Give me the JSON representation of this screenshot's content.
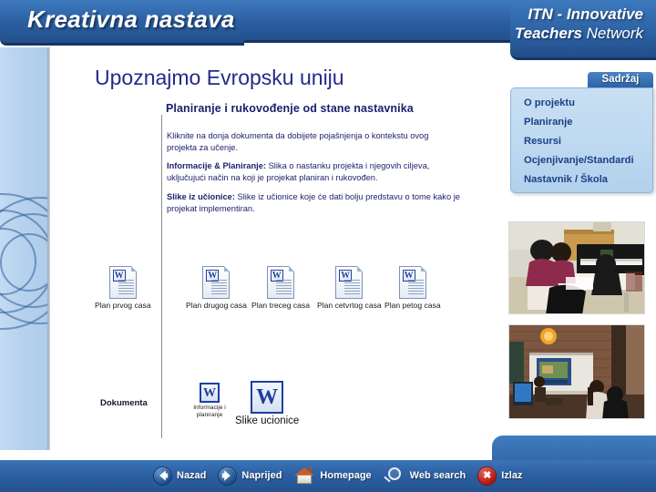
{
  "header": {
    "brand_title": "Kreativna nastava",
    "itn_line1": "ITN - Innovative",
    "itn_line2_bold": "Teachers",
    "itn_line2_thin": "Network"
  },
  "main": {
    "title": "Upoznajmo Evropsku uniju",
    "subtitle": "Planiranje i rukovođenje od stane nastavnika",
    "paragraph_1": "Kliknite na donja dokumenta da dobijete pojašnjenja o kontekstu ovog projekta za učenje.",
    "paragraph_2_bold": "Informacije & Planiranje:",
    "paragraph_2_rest": " Slika o nastanku projekta i njegovih ciljeva, uključujući način na koji je projekat planiran i rukovođen.",
    "paragraph_3_bold": "Slike iz učionice:",
    "paragraph_3_rest": " Slike iz učionice koje će dati bolju predstavu o tome kako je projekat implementiran."
  },
  "documents": {
    "section_label": "Dokumenta",
    "word_glyph": "W",
    "plans": [
      {
        "caption": "Plan prvog casa"
      },
      {
        "caption": "Plan drugog casa"
      },
      {
        "caption": "Plan treceg casa"
      },
      {
        "caption": "Plan cetvrtog casa"
      },
      {
        "caption": "Plan petog casa"
      }
    ],
    "small_doc_caption_line1": "Informacije i",
    "small_doc_caption_line2": "planiranje",
    "big_doc_caption": "Slike ucionice"
  },
  "sidebar": {
    "tab_label": "Sadržaj",
    "items": [
      {
        "label": "O  projektu"
      },
      {
        "label": "Planiranje"
      },
      {
        "label": "Resursi"
      },
      {
        "label": "Ocjenjivanje/Standardi"
      },
      {
        "label": "Nastavnik / Škola"
      }
    ]
  },
  "photos": [
    {
      "name": "students-planning-at-table"
    },
    {
      "name": "classroom-projector-presentation"
    }
  ],
  "footer": {
    "nav": [
      {
        "label": "Nazad",
        "icon": "arrow-left-icon"
      },
      {
        "label": "Naprijed",
        "icon": "arrow-right-icon"
      },
      {
        "label": "Homepage",
        "icon": "home-icon"
      },
      {
        "label": "Web search",
        "icon": "magnifier-icon"
      },
      {
        "label": "Izlaz",
        "icon": "close-x-icon"
      }
    ]
  },
  "colors": {
    "header_blue": "#2b5ea0",
    "title_navy": "#222a8c",
    "sidebar_panel": "#bcd8f0",
    "sidebar_text": "#1b3f86",
    "left_band": "#b6d2ee",
    "exit_red": "#b11710"
  }
}
